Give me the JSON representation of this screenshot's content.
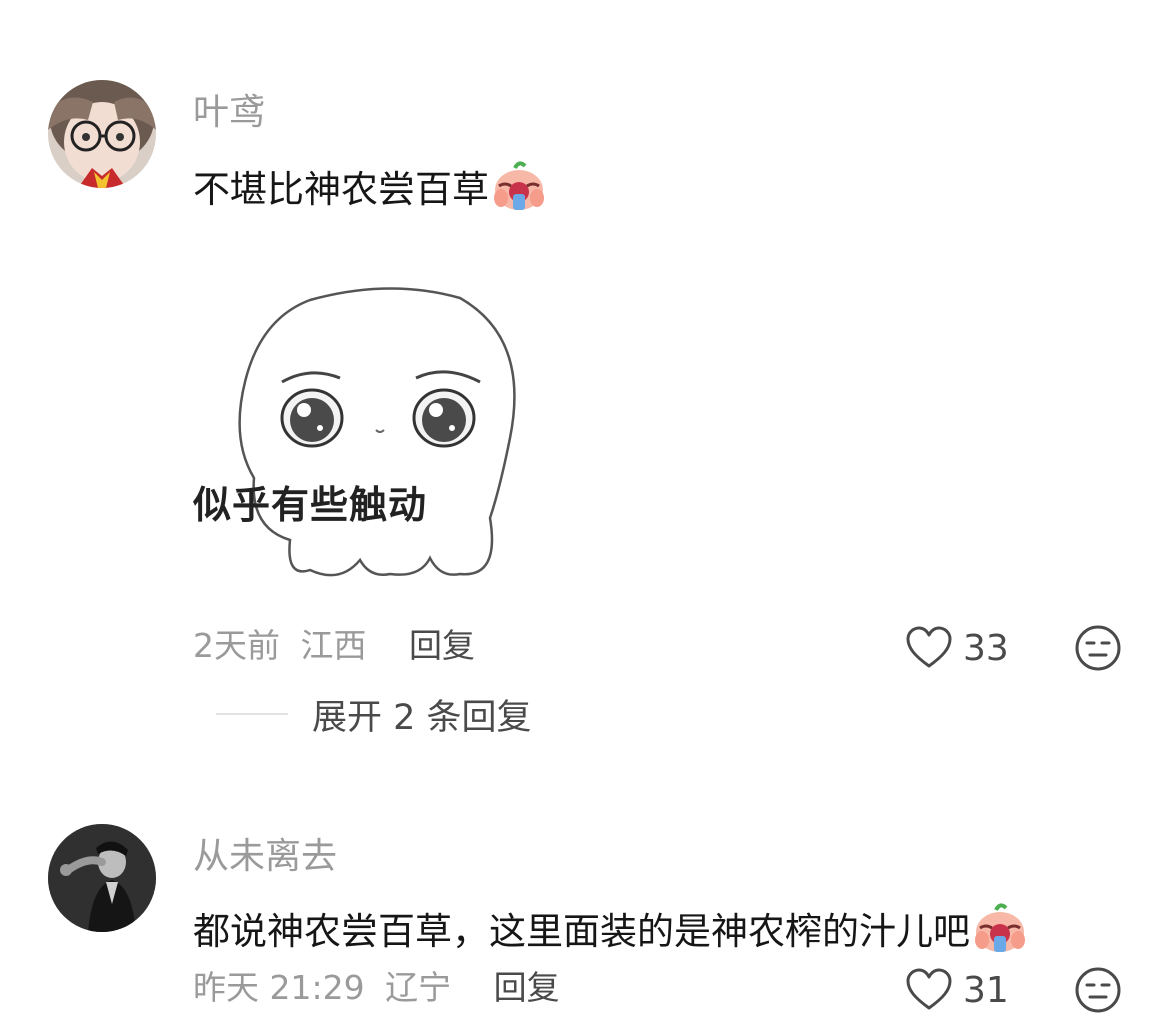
{
  "comments": [
    {
      "username": "叶鸢",
      "text": "不堪比神农尝百草",
      "emoji": "crying-eating-emoji",
      "sticker": {
        "caption": "似乎有些触动",
        "icon": "octopus-sticker"
      },
      "time": "2天前",
      "location": "江西",
      "reply_label": "回复",
      "likes": "33",
      "expand_label": "展开 2 条回复"
    },
    {
      "username": "从未离去",
      "text": "都说神农尝百草，这里面装的是神农榨的汁儿吧",
      "emoji": "crying-eating-emoji",
      "time": "昨天 21:29",
      "location": "辽宁",
      "reply_label": "回复",
      "likes": "31"
    }
  ],
  "icons": {
    "like": "heart-outline-icon",
    "dislike": "unamused-face-icon"
  },
  "colors": {
    "meta_text": "#9a9a9a",
    "action_text": "#4a4a4a",
    "body_text": "#161616"
  }
}
